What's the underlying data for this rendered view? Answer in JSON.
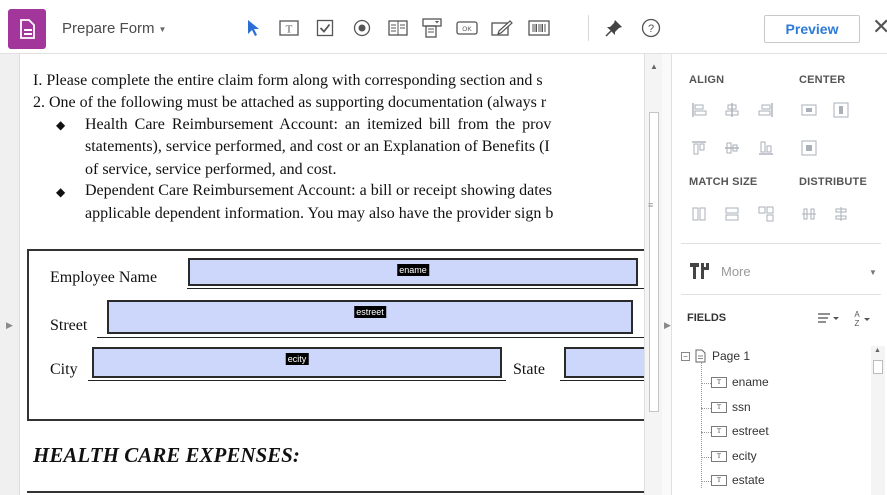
{
  "toolbar": {
    "tool_name": "Prepare Form",
    "preview_label": "Preview",
    "icons": [
      "select-arrow-icon",
      "text-field-icon",
      "checkbox-icon",
      "radio-button-icon",
      "list-box-icon",
      "dropdown-icon",
      "button-icon",
      "signature-icon",
      "barcode-icon",
      "pin-icon",
      "help-icon"
    ],
    "accent_color": "#a3369a",
    "close_glyph": "✕"
  },
  "document": {
    "lines": [
      "I.  Please complete the entire claim form along with corresponding section and s",
      "2.  One of the following must be attached as supporting documentation (always r",
      "Health Care Reimbursement Account:  an itemized bill from the prov",
      "statements), service performed, and cost or an Explanation of Benefits (I",
      "of service, service performed, and cost.",
      "Dependent Care Reimbursement Account: a bill or receipt showing dates",
      "applicable dependent information.  You may also have the provider sign b"
    ],
    "labels": {
      "employee_name": "Employee Name",
      "street": "Street",
      "city": "City",
      "state": "State"
    },
    "fields": {
      "ename": "ename",
      "estreet": "estreet",
      "ecity": "ecity"
    },
    "section_title": "HEALTH CARE EXPENSES:"
  },
  "panel": {
    "align_label": "ALIGN",
    "center_label": "CENTER",
    "match_size_label": "MATCH SIZE",
    "distribute_label": "DISTRIBUTE",
    "more_label": "More",
    "fields_label": "FIELDS",
    "tree": {
      "page": "Page 1",
      "fields": [
        "ename",
        "ssn",
        "estreet",
        "ecity",
        "estate"
      ]
    }
  }
}
